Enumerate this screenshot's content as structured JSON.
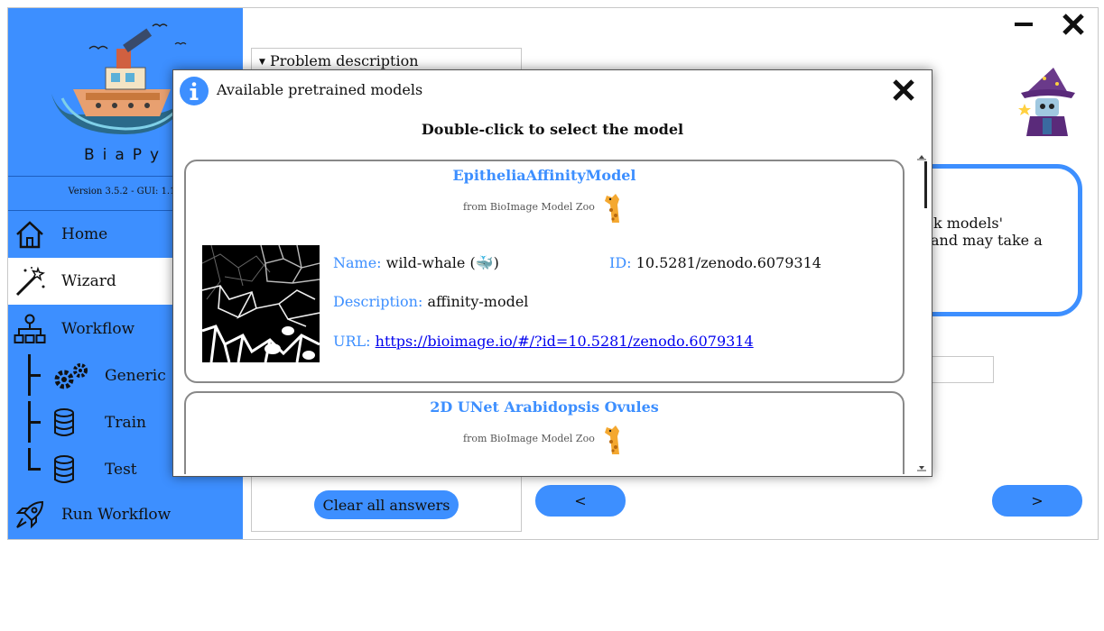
{
  "app": {
    "logo_text": "BiaPy",
    "version": "Version 3.5.2 - GUI: 1.1"
  },
  "sidebar": {
    "items": [
      {
        "label": "Home",
        "icon": "home-icon"
      },
      {
        "label": "Wizard",
        "icon": "wand-icon"
      },
      {
        "label": "Workflow",
        "icon": "workflow-icon"
      },
      {
        "label": "Generic",
        "icon": "gears-icon"
      },
      {
        "label": "Train",
        "icon": "database-icon"
      },
      {
        "label": "Test",
        "icon": "database-icon"
      },
      {
        "label": "Run Workflow",
        "icon": "rocket-icon"
      }
    ]
  },
  "main": {
    "problem_description_label": "Problem description",
    "clear_button": "Clear all answers",
    "prev_button": "<",
    "next_button": ">",
    "question_fragment_1": "ck models'",
    "question_fragment_2": "and may take a"
  },
  "modal": {
    "title": "Available pretrained models",
    "subtitle": "Double-click to select the model",
    "models": [
      {
        "title": "EpitheliaAffinityModel",
        "source": "from BioImage Model Zoo",
        "name_key": "Name:",
        "name_value": "wild-whale (🐳)",
        "id_key": "ID:",
        "id_value": "10.5281/zenodo.6079314",
        "description_key": "Description:",
        "description_value": "affinity-model",
        "url_key": "URL:",
        "url_value": "https://bioimage.io/#/?id=10.5281/zenodo.6079314"
      },
      {
        "title": "2D UNet Arabidopsis Ovules",
        "source": "from BioImage Model Zoo"
      }
    ]
  },
  "colors": {
    "accent": "#3d8fff",
    "link": "#0000ee"
  }
}
